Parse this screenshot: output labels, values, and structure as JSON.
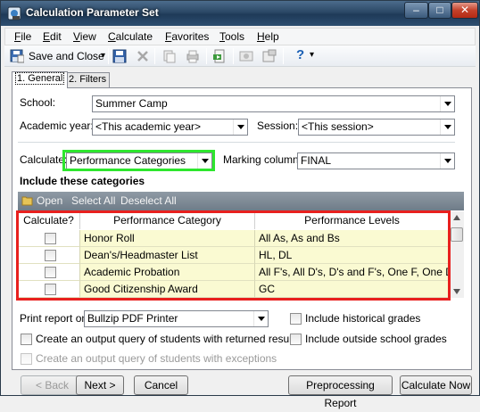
{
  "window": {
    "title": "Calculation Parameter Set",
    "min_glyph": "–",
    "max_glyph": "□",
    "close_glyph": "✕"
  },
  "menu": [
    "File",
    "Edit",
    "View",
    "Calculate",
    "Favorites",
    "Tools",
    "Help"
  ],
  "toolbar": {
    "save_close_label": "Save and Close",
    "dropdown_glyph": "▾",
    "help_glyph": "?"
  },
  "tabs": [
    {
      "label": "1. General"
    },
    {
      "label": "2. Filters"
    }
  ],
  "form": {
    "school_label": "School:",
    "school_value": "Summer Camp",
    "academic_year_label": "Academic year:",
    "academic_year_value": "<This academic year>",
    "session_label": "Session:",
    "session_value": "<This session>",
    "calculate_label": "Calculate:",
    "calculate_value": "Performance Categories",
    "marking_column_label": "Marking column:",
    "marking_column_value": "FINAL"
  },
  "categories": {
    "section_title": "Include these categories",
    "toolbar": {
      "open": "Open",
      "select_all": "Select All",
      "deselect_all": "Deselect All"
    },
    "columns": [
      "Calculate?",
      "Performance Category",
      "Performance Levels"
    ],
    "rows": [
      {
        "calculate": false,
        "category": "Honor Roll",
        "levels": "All As, As and Bs"
      },
      {
        "calculate": false,
        "category": "Dean's/Headmaster List",
        "levels": "HL, DL"
      },
      {
        "calculate": false,
        "category": "Academic Probation",
        "levels": "All F's, All D's, D's and F's, One F, One D"
      },
      {
        "calculate": false,
        "category": "Good Citizenship Award",
        "levels": "GC"
      }
    ]
  },
  "options": {
    "print_report_label": "Print report on",
    "print_report_value": "Bullzip PDF Printer",
    "include_historical": "Include historical grades",
    "include_outside": "Include outside school grades",
    "output_returned": "Create an output query of students with returned results",
    "output_exceptions": "Create an output query of students with exceptions"
  },
  "buttons": {
    "back": "< Back",
    "next": "Next >",
    "cancel": "Cancel",
    "preprocessing": "Preprocessing Report",
    "calculate_now": "Calculate Now"
  }
}
